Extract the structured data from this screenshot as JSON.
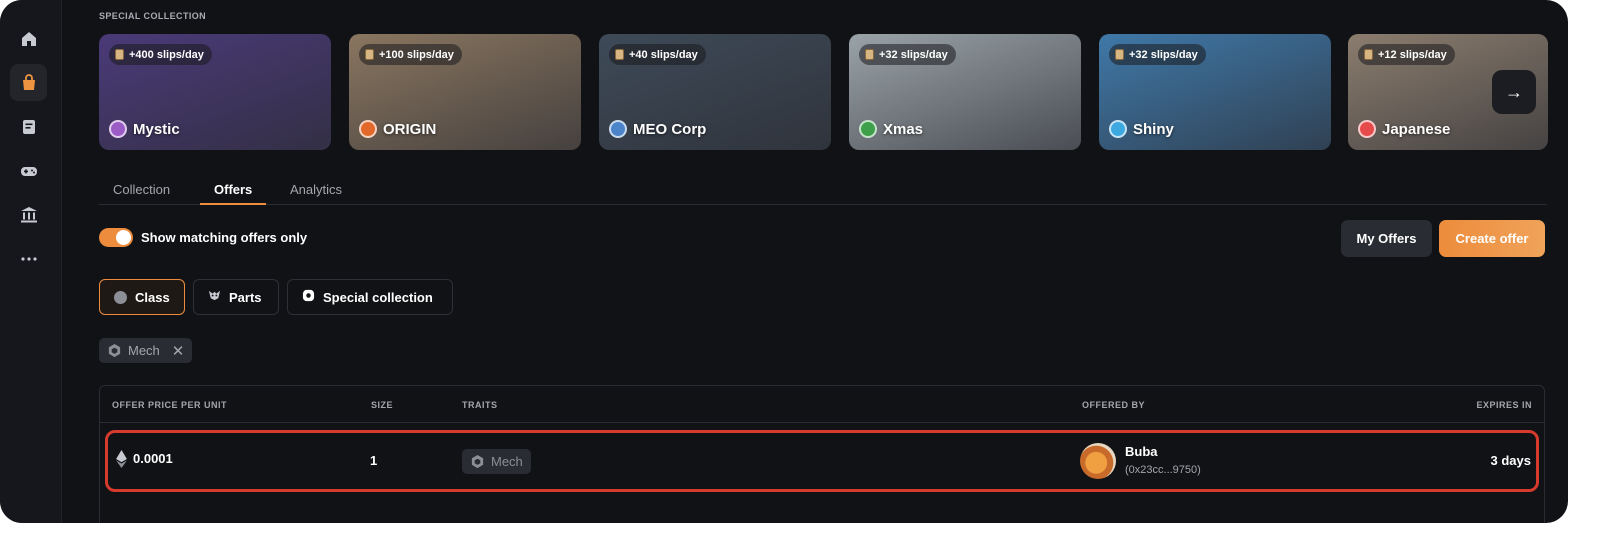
{
  "sidebar": {
    "items": [
      {
        "name": "home-icon",
        "active": false
      },
      {
        "name": "shopping-bag-icon",
        "active": true
      },
      {
        "name": "document-icon",
        "active": false
      },
      {
        "name": "gamepad-icon",
        "active": false
      },
      {
        "name": "bank-icon",
        "active": false
      },
      {
        "name": "more-icon",
        "active": false
      }
    ]
  },
  "special_collection": {
    "label": "SPECIAL COLLECTION",
    "cards": [
      {
        "badge": "+400 slips/day",
        "name": "Mystic",
        "icon_color": "#9b5cc6",
        "bg": "#4a3a78"
      },
      {
        "badge": "+100 slips/day",
        "name": "ORIGIN",
        "icon_color": "#e2682c",
        "bg": "#8a7660"
      },
      {
        "badge": "+40 slips/day",
        "name": "MEO Corp",
        "icon_color": "#4b84c8",
        "bg": "#3e4a58"
      },
      {
        "badge": "+32 slips/day",
        "name": "Xmas",
        "icon_color": "#3ea04a",
        "bg": "#9aa3a8"
      },
      {
        "badge": "+32 slips/day",
        "name": "Shiny",
        "icon_color": "#3ea8e0",
        "bg": "#3f78a8"
      },
      {
        "badge": "+12 slips/day",
        "name": "Japanese",
        "icon_color": "#e64a4a",
        "bg": "#8b7d6e"
      }
    ],
    "next_icon": "arrow-right-icon"
  },
  "tabs": [
    {
      "label": "Collection",
      "active": false
    },
    {
      "label": "Offers",
      "active": true
    },
    {
      "label": "Analytics",
      "active": false
    }
  ],
  "toggle": {
    "label": "Show matching offers only",
    "on": true
  },
  "buttons": {
    "my_offers": "My Offers",
    "create_offer": "Create offer"
  },
  "filters": [
    {
      "label": "Class",
      "icon": "circle-icon",
      "active": true
    },
    {
      "label": "Parts",
      "icon": "parts-icon",
      "active": false
    },
    {
      "label": "Special collection",
      "icon": "special-collection-icon",
      "active": false
    }
  ],
  "active_filter_chip": {
    "label": "Mech",
    "icon": "mech-hex-icon",
    "remove_icon": "close-icon"
  },
  "table": {
    "headers": {
      "price": "OFFER PRICE PER UNIT",
      "size": "SIZE",
      "traits": "TRAITS",
      "offered_by": "OFFERED BY",
      "expires": "EXPIRES IN"
    },
    "rows": [
      {
        "price": "0.0001",
        "currency_icon": "ethereum-icon",
        "size": "1",
        "trait": "Mech",
        "offerer_name": "Buba",
        "offerer_address": "(0x23cc...9750)",
        "expires": "3 days"
      }
    ]
  },
  "colors": {
    "accent": "#ec8c3c",
    "highlight_border": "#d63a2c",
    "background": "#111216"
  }
}
